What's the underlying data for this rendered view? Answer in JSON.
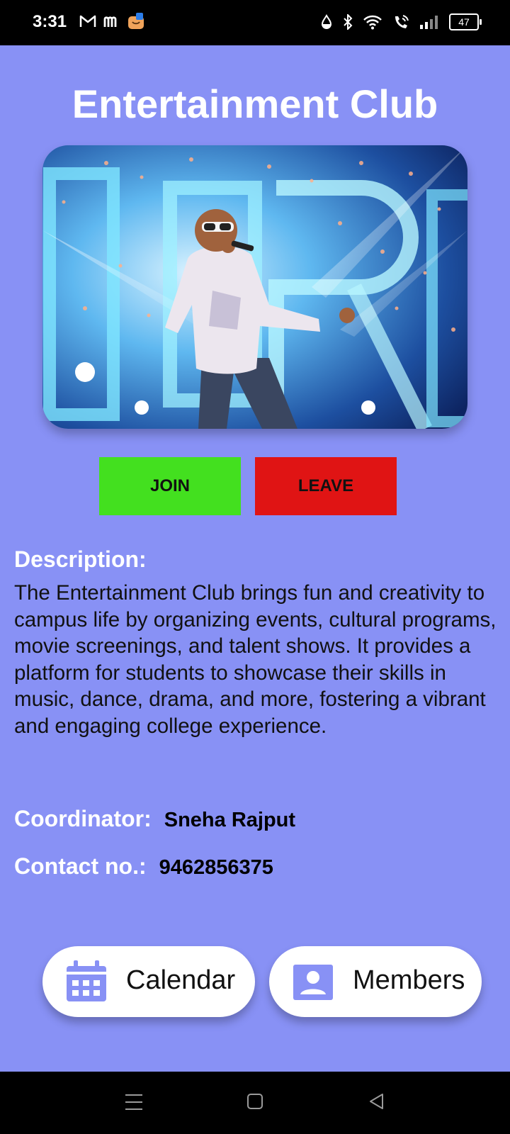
{
  "status_bar": {
    "time": "3:31",
    "battery": "47",
    "left_icons": [
      "gmail-icon",
      "m-app-icon",
      "shopping-bag-icon"
    ],
    "right_icons": [
      "data-saver-icon",
      "bluetooth-icon",
      "wifi-icon",
      "wifi-call-icon",
      "signal-icon",
      "battery-icon"
    ]
  },
  "page": {
    "title": "Entertainment Club"
  },
  "actions": {
    "join_label": "JOIN",
    "join_color": "#43e01f",
    "leave_label": "LEAVE",
    "leave_color": "#e01414"
  },
  "description": {
    "heading": "Description:",
    "text": "The Entertainment Club brings fun and creativity to campus life by organizing events, cultural programs, movie screenings, and talent shows. It provides a platform for students to showcase their skills in music, dance, drama, and more, fostering a vibrant and engaging college experience."
  },
  "coordinator": {
    "label": "Coordinator:",
    "name": "Sneha Rajput"
  },
  "contact": {
    "label": "Contact no.:",
    "number": "9462856375"
  },
  "bottom_buttons": {
    "calendar_label": "Calendar",
    "calendar_icon": "calendar-icon",
    "members_label": "Members",
    "members_icon": "person-icon"
  },
  "system_nav": {
    "icons": [
      "menu-icon",
      "home-icon",
      "back-icon"
    ]
  },
  "colors": {
    "background": "#8891f5",
    "accent_icon": "#8891f5"
  }
}
